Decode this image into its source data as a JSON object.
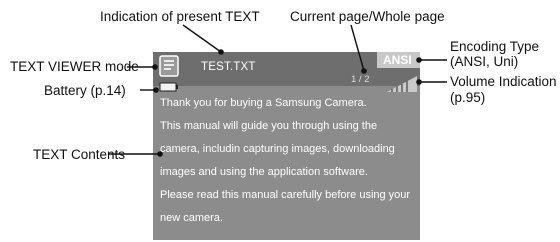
{
  "callouts": {
    "present_text": "Indication of present TEXT",
    "page_info": "Current page/Whole page",
    "viewer_mode": "TEXT VIEWER mode",
    "battery": "Battery (p.14)",
    "contents": "TEXT Contents",
    "encoding_line1": "Encoding Type",
    "encoding_line2": "(ANSI, Uni)",
    "volume_line1": "Volume Indication",
    "volume_line2": "(p.95)"
  },
  "screen": {
    "file_name": "TEST.TXT",
    "page_indicator": "1 / 2",
    "encoding": "ANSI",
    "content_lines": [
      "Thank you for buying a Samsung Camera.",
      "This manual will guide you through using the",
      "camera, includin capturing images, downloading",
      "images and using the application software.",
      "Please read this manual carefully before using your",
      "new camera."
    ]
  },
  "colors": {
    "screen_bg": "#8c8c8c",
    "topbar_bg": "#6e6e6e",
    "callout_line": "#111111"
  }
}
